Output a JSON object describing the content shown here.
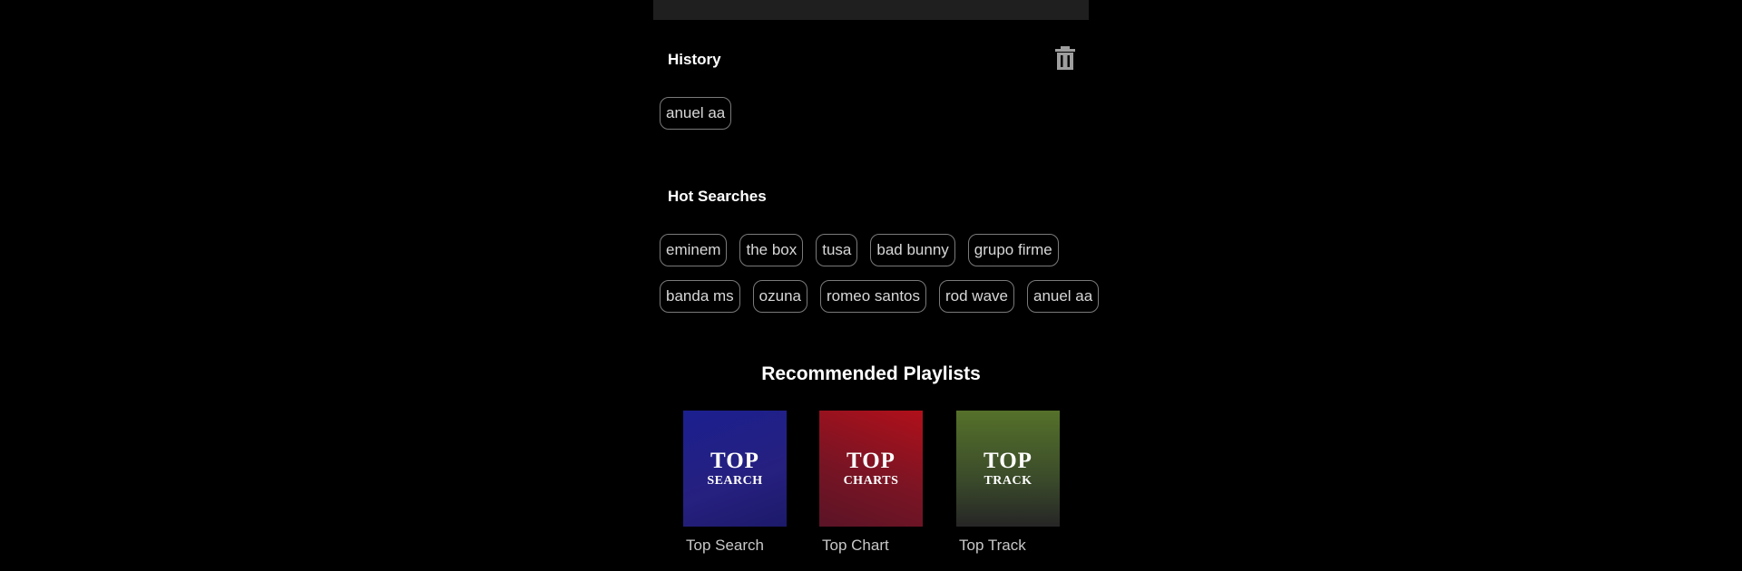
{
  "history": {
    "title": "History",
    "clear_icon": "trash-icon",
    "items": [
      "anuel aa"
    ]
  },
  "hot_searches": {
    "title": "Hot Searches",
    "row1": [
      "eminem",
      "the box",
      "tusa",
      "bad bunny",
      "grupo firme"
    ],
    "row2": [
      "banda ms",
      "ozuna",
      "romeo santos",
      "rod wave",
      "anuel aa"
    ]
  },
  "recommended": {
    "title": "Recommended Playlists",
    "playlists": [
      {
        "cover_top": "TOP",
        "cover_sub": "SEARCH",
        "label": "Top Search",
        "color": "#1b1f8f"
      },
      {
        "cover_top": "TOP",
        "cover_sub": "CHARTS",
        "label": "Top Chart",
        "color": "#b0101a"
      },
      {
        "cover_top": "TOP",
        "cover_sub": "TRACK",
        "label": "Top Track",
        "color": "#55712a"
      }
    ]
  }
}
